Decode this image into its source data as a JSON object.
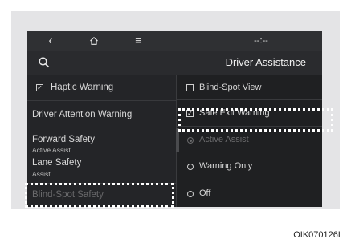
{
  "nav": {
    "back_glyph": "‹",
    "home_icon": "home-icon",
    "menu_glyph": "≡",
    "status_glyph": "--:--"
  },
  "header": {
    "title": "Driver Assistance",
    "search_icon": "search-icon"
  },
  "left_menu": {
    "items": [
      {
        "label": "Haptic Warning",
        "checked": true
      },
      {
        "label": "Driver Attention Warning"
      },
      {
        "label": "Forward Safety",
        "sublabel": "Active Assist"
      },
      {
        "label": "Lane Safety",
        "sublabel": "Assist"
      },
      {
        "label": "Blind-Spot Safety",
        "disabled": true
      }
    ]
  },
  "right_panel": {
    "blind_spot_view": {
      "label": "Blind-Spot View",
      "checked": false
    },
    "safe_exit_warning": {
      "label": "Safe Exit Warning",
      "checked": true
    },
    "options": [
      {
        "label": "Active Assist",
        "selected": true,
        "disabled": true
      },
      {
        "label": "Warning Only",
        "selected": false
      },
      {
        "label": "Off",
        "selected": false
      }
    ]
  },
  "caption": "OIK070126L",
  "colors": {
    "screen_bg": "#1f2022",
    "highlight": "#ffffff",
    "disabled_text": "#6a6a6c"
  }
}
